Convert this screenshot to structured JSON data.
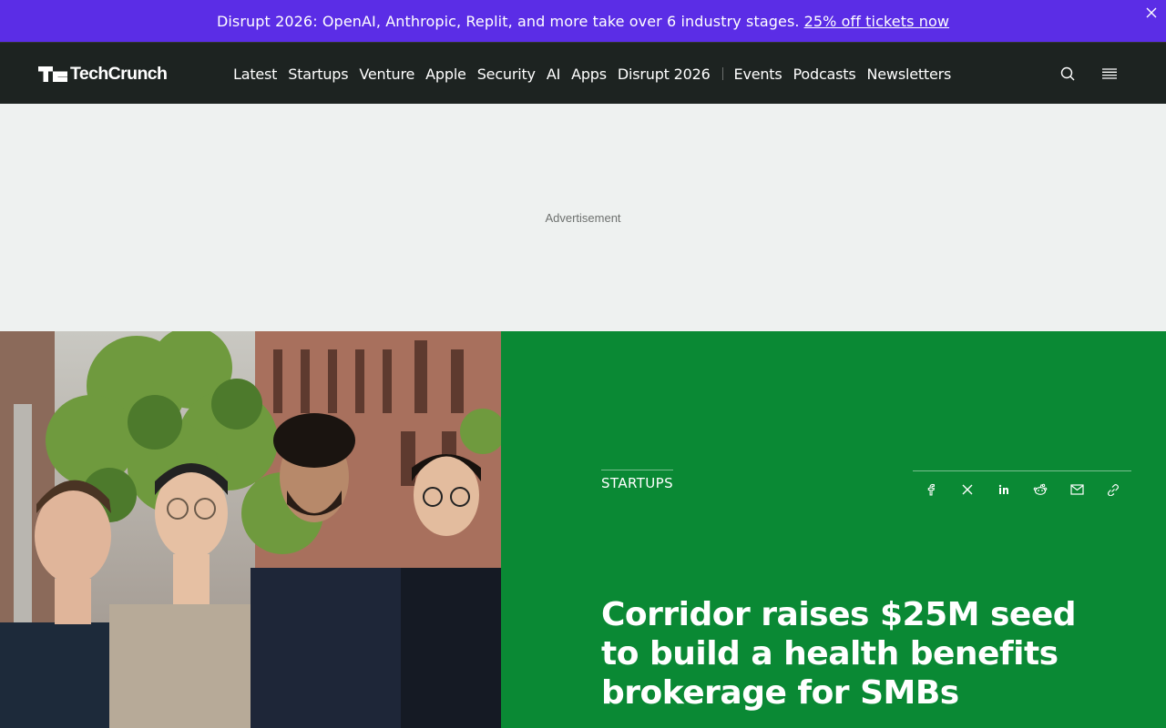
{
  "promo": {
    "text": "Disrupt 2026: OpenAI, Anthropic, Replit, and more take over 6 industry stages.",
    "link": "25% off tickets now",
    "close_icon": "close-icon",
    "bg_color": "#5b2de6"
  },
  "header": {
    "logo_text": "TechCrunch",
    "nav_primary": [
      "Latest",
      "Startups",
      "Venture",
      "Apple",
      "Security",
      "AI",
      "Apps",
      "Disrupt 2026"
    ],
    "nav_secondary": [
      "Events",
      "Podcasts",
      "Newsletters"
    ],
    "icons": [
      "search-icon",
      "menu-icon"
    ]
  },
  "ad": {
    "label": "Advertisement"
  },
  "article": {
    "category": "STARTUPS",
    "headline": "Corridor raises $25M seed to build a health benefits brokerage for SMBs",
    "panel_color": "#0a8934",
    "share_icons": [
      "facebook-icon",
      "x-icon",
      "linkedin-icon",
      "reddit-icon",
      "email-icon",
      "link-icon"
    ]
  }
}
